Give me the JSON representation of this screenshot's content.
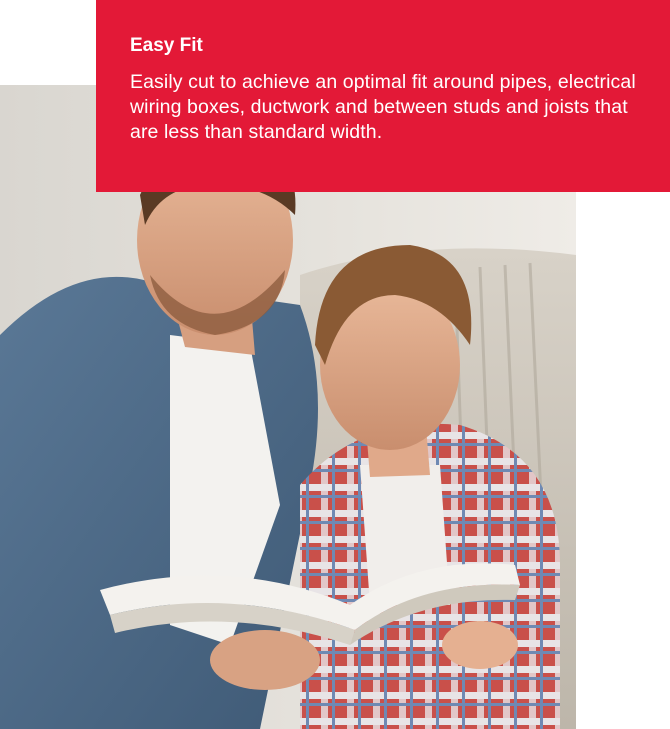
{
  "callout": {
    "title": "Easy Fit",
    "body": "Easily cut to achieve an optimal fit around pipes, electrical wiring boxes, ductwork and between studs and joists that are less than standard width."
  },
  "photo": {
    "subject": "father-and-son-reading-book-photo"
  },
  "colors": {
    "callout_background": "#e31937",
    "callout_text": "#ffffff",
    "page_background": "#ffffff"
  }
}
